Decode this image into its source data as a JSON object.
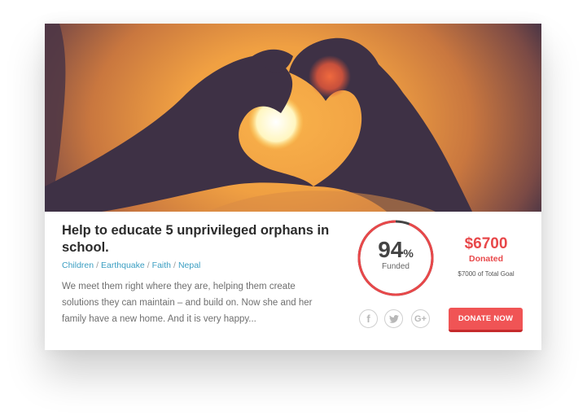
{
  "campaign": {
    "title": "Help to educate 5 unprivileged orphans in school.",
    "tags": [
      "Children",
      "Earthquake",
      "Faith",
      "Nepal"
    ],
    "tag_separator": "/",
    "description": "We meet them right where they are, helping them create solutions they can maintain – and build on. Now she and her family have a new home. And it is very happy...",
    "image_alt": "Silhouette of hands forming a heart shape around the setting sun"
  },
  "progress": {
    "percent_value": "94",
    "percent_symbol": "%",
    "label": "Funded",
    "fraction": 0.94
  },
  "funding": {
    "amount": "$6700",
    "amount_label": "Donated",
    "goal_text": "$7000 of Total Goal"
  },
  "social": [
    {
      "name": "facebook",
      "glyph": "f"
    },
    {
      "name": "twitter",
      "glyph": "t"
    },
    {
      "name": "google-plus",
      "glyph": "G+"
    }
  ],
  "actions": {
    "donate_label": "DONATE NOW"
  },
  "colors": {
    "accent": "#e8484a",
    "button": "#f05455",
    "tag_link": "#3a9ec2",
    "gauge_remaining": "#444444"
  }
}
